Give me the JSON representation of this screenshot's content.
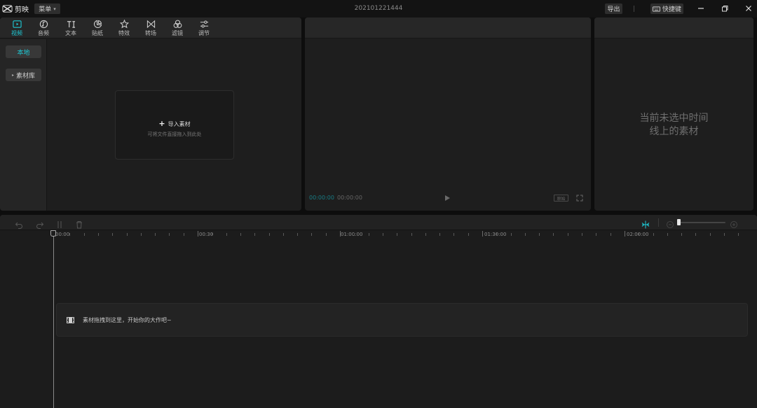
{
  "app": {
    "name": "剪映",
    "menu_label": "菜单",
    "project_title": "202101221444",
    "export_label": "导出",
    "shortcut_label": "快捷键"
  },
  "media": {
    "tabs": [
      {
        "label": "视频",
        "icon": "video-icon",
        "active": true
      },
      {
        "label": "音频",
        "icon": "audio-icon",
        "active": false
      },
      {
        "label": "文本",
        "icon": "text-icon",
        "active": false
      },
      {
        "label": "贴纸",
        "icon": "sticker-icon",
        "active": false
      },
      {
        "label": "特效",
        "icon": "effects-icon",
        "active": false
      },
      {
        "label": "转场",
        "icon": "transition-icon",
        "active": false
      },
      {
        "label": "滤镜",
        "icon": "filter-icon",
        "active": false
      },
      {
        "label": "调节",
        "icon": "adjust-icon",
        "active": false
      }
    ],
    "side": {
      "local_label": "本地",
      "library_label": "素材库"
    },
    "import": {
      "label": "导入素材",
      "hint": "可将文件直接拖入到此处"
    }
  },
  "preview": {
    "current_time": "00:00:00",
    "total_time": "00:00:00",
    "ratio_label": "原始"
  },
  "properties": {
    "empty_line1": "当前未选中时间",
    "empty_line2": "线上的素材"
  },
  "timeline": {
    "ruler_labels": [
      "00:00",
      "00:30",
      "01:00:00",
      "01:30:00",
      "02:00:00"
    ],
    "zoom_level": 0.0,
    "drop_hint": "素材拖拽到这里，开始你的大作吧~"
  },
  "colors": {
    "accent": "#1ec8d4",
    "panel": "#1e1e1e",
    "background": "#0d0d0d"
  }
}
